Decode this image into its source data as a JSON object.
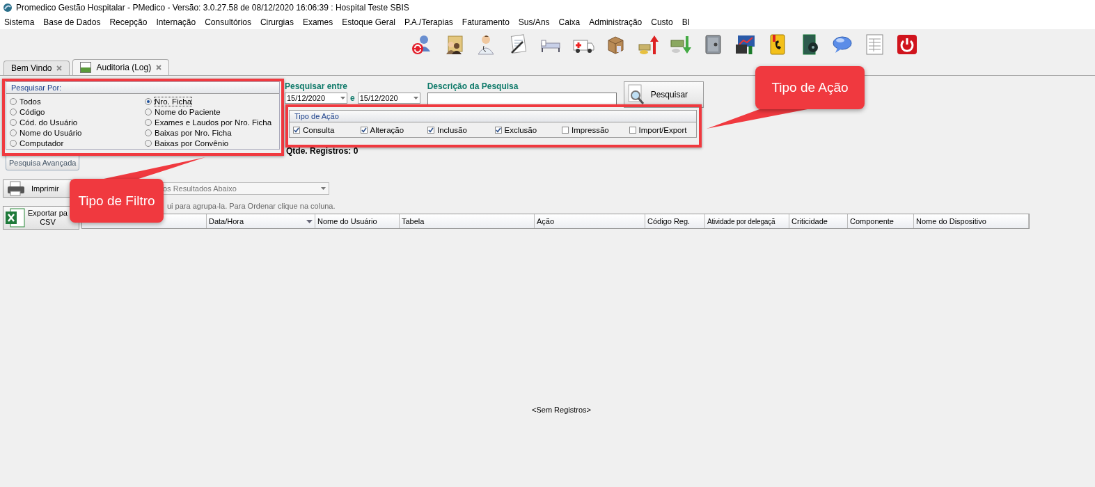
{
  "window": {
    "title": "Promedico Gestão Hospitalar - PMedico - Versão: 3.0.27.58 de 08/12/2020 16:06:39 : Hospital Teste SBIS"
  },
  "menu": [
    "Sistema",
    "Base de Dados",
    "Recepção",
    "Internação",
    "Consultórios",
    "Cirurgias",
    "Exames",
    "Estoque Geral",
    "P.A./Terapias",
    "Faturamento",
    "Sus/Ans",
    "Caixa",
    "Administração",
    "Custo",
    "BI"
  ],
  "tabs": [
    {
      "label": "Bem Vindo",
      "selected": false
    },
    {
      "label": "Auditoria (Log)",
      "selected": true
    }
  ],
  "filter_group": {
    "title": "Pesquisar Por:",
    "options": [
      {
        "label": "Todos",
        "selected": false
      },
      {
        "label": "Código",
        "selected": false
      },
      {
        "label": "Cód. do Usuário",
        "selected": false
      },
      {
        "label": "Nome do Usuário",
        "selected": false
      },
      {
        "label": "Computador",
        "selected": false
      },
      {
        "label": "Nro. Ficha",
        "selected": true
      },
      {
        "label": "Nome do Paciente",
        "selected": false
      },
      {
        "label": "Exames e Laudos por Nro. Ficha",
        "selected": false
      },
      {
        "label": "Baixas por Nro. Ficha",
        "selected": false
      },
      {
        "label": "Baixas por Convênio",
        "selected": false
      }
    ]
  },
  "date_range": {
    "label": "Pesquisar entre",
    "from": "15/12/2020",
    "connector": "e",
    "to": "15/12/2020"
  },
  "description": {
    "label": "Descrição da Pesquisa"
  },
  "search_button": "Pesquisar",
  "action_type": {
    "title": "Tipo de Ação",
    "options": [
      {
        "label": "Consulta",
        "checked": true
      },
      {
        "label": "Alteração",
        "checked": true
      },
      {
        "label": "Inclusão",
        "checked": true
      },
      {
        "label": "Exclusão",
        "checked": true
      },
      {
        "label": "Impressão",
        "checked": false
      },
      {
        "label": "Import/Export",
        "checked": false
      }
    ]
  },
  "record_count": "Qtde. Registros: 0",
  "advanced_button": "Pesquisa Avançada",
  "print_button": "Imprimir",
  "print_combo": "os Resultados Abaixo",
  "group_hint": "ui para agrupa-la. Para Ordenar clique na coluna.",
  "export_button": [
    "Exportar pa",
    "CSV"
  ],
  "grid": {
    "columns": [
      {
        "sorted": false
      },
      {
        "label": "Data/Hora",
        "sorted": true
      },
      {
        "label": "Nome do Usuário",
        "sorted": false
      },
      {
        "label": "Tabela",
        "sorted": false
      },
      {
        "label": "Ação",
        "sorted": false
      },
      {
        "label": "Código Reg.",
        "sorted": false
      },
      {
        "label": "Atividade por delegaçã",
        "sorted": false
      },
      {
        "label": "Criticidade",
        "sorted": false
      },
      {
        "label": "Componente",
        "sorted": false
      },
      {
        "label": "Nome do Dispositivo",
        "sorted": false
      }
    ],
    "empty_text": "<Sem Registros>"
  },
  "annotations": [
    {
      "text": "Tipo de Filtro",
      "kind": "filter"
    },
    {
      "text": "Tipo de Ação",
      "kind": "action"
    }
  ]
}
